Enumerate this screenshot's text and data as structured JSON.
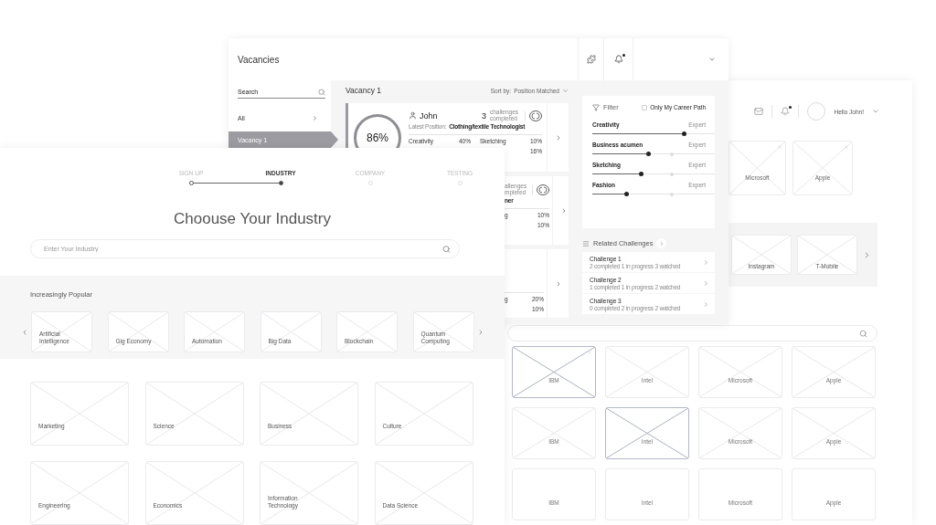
{
  "company_window": {
    "greeting": "Hello John!",
    "favorites": [
      {
        "label": "Microsoft"
      },
      {
        "label": "Apple"
      }
    ],
    "suggested": [
      {
        "label": "Instagram"
      },
      {
        "label": "T-Mobile"
      }
    ],
    "companies": [
      {
        "label": "IBM",
        "kind": "image",
        "selected": true
      },
      {
        "label": "Intel",
        "kind": "image",
        "selected": false
      },
      {
        "label": "Microsoft",
        "kind": "image",
        "selected": false
      },
      {
        "label": "Apple",
        "kind": "image",
        "selected": false
      },
      {
        "label": "IBM",
        "kind": "image",
        "selected": false
      },
      {
        "label": "Intel",
        "kind": "image",
        "selected": true
      },
      {
        "label": "Microsoft",
        "kind": "image",
        "selected": false
      },
      {
        "label": "Apple",
        "kind": "image",
        "selected": false
      },
      {
        "label": "IBM",
        "kind": "blank",
        "selected": false
      },
      {
        "label": "Intel",
        "kind": "blank",
        "selected": false
      },
      {
        "label": "Microsoft",
        "kind": "blank",
        "selected": false
      },
      {
        "label": "Apple",
        "kind": "blank",
        "selected": false
      }
    ]
  },
  "vacancies_window": {
    "title": "Vacancies",
    "sidebar": {
      "search": {
        "placeholder": "Search"
      },
      "items": [
        {
          "label": "All",
          "selected": false
        },
        {
          "label": "Vacancy 1",
          "selected": true
        }
      ]
    },
    "main": {
      "title": "Vacancy 1",
      "sort_label": "Sort by:",
      "sort_value": "Position Matched",
      "candidates": [
        {
          "kind": "full",
          "match": "86%",
          "name": "John",
          "challenges_count": "3",
          "challenges_label": "challenges completed",
          "position_label": "Latest Position:",
          "position": "Clothing/textile Technologist",
          "skill_rows": [
            [
              {
                "name": "Creativity",
                "value": "40%"
              },
              {
                "name": "Sketching",
                "value": "10%"
              }
            ],
            [
              {
                "value": "16%"
              }
            ]
          ]
        },
        {
          "kind": "partial",
          "challenges_label": "allenges mpleted",
          "position": "ner",
          "skill_rows": [
            [
              {
                "name": "g",
                "value": "10%"
              }
            ],
            [
              {
                "value": "10%"
              }
            ]
          ]
        },
        {
          "kind": "partial",
          "skill_rows": [
            [
              {
                "name": "g",
                "value": "20%"
              }
            ],
            [
              {
                "value": "10%"
              }
            ]
          ]
        }
      ]
    },
    "filter": {
      "title": "Filter",
      "career_path": {
        "label": "Only My Career Path",
        "checked": false
      },
      "skills": [
        {
          "name": "Creativity",
          "max_label": "Expert",
          "level": 0.75
        },
        {
          "name": "Business acumen",
          "max_label": "Expert",
          "level": 0.46,
          "benchmark": {
            "level": 0.65
          }
        },
        {
          "name": "Sketching",
          "max_label": "Expert",
          "level": 0.4,
          "benchmark": {
            "level": 0.65
          }
        },
        {
          "name": "Fashion",
          "max_label": "Expert",
          "level": 0.28,
          "benchmark": {
            "level": 0.65
          }
        }
      ]
    },
    "related": {
      "title": "Related Challenges",
      "challenges": [
        {
          "title": "Challenge 1",
          "completed": "2 completed",
          "in_progress": "1 in progress",
          "watched": "3 watched"
        },
        {
          "title": "Challenge 2",
          "completed": "1 completed",
          "in_progress": "1 in progress",
          "watched": "2 watched"
        },
        {
          "title": "Challenge 3",
          "completed": "0 completed",
          "in_progress": "2 in progress",
          "watched": "2 watched"
        }
      ]
    }
  },
  "industry_window": {
    "steps": [
      {
        "label": "SIGN UP",
        "completed": true,
        "selected": false
      },
      {
        "label": "INDUSTRY",
        "completed": false,
        "selected": true
      },
      {
        "label": "COMPANY",
        "completed": false,
        "selected": false
      },
      {
        "label": "TESTING",
        "completed": false,
        "selected": false
      }
    ],
    "title": "Choouse Your Industry",
    "search": {
      "placeholder": "Enter Your Industry"
    },
    "popular": {
      "title": "Increasingly Popular",
      "items": [
        {
          "label": "Artificial Intelligence"
        },
        {
          "label": "Gig Economy"
        },
        {
          "label": "Automation"
        },
        {
          "label": "Big Data"
        },
        {
          "label": "Blockchain"
        },
        {
          "label": "Quantum Computing"
        }
      ]
    },
    "industries": [
      {
        "label": "Marketing"
      },
      {
        "label": "Science"
      },
      {
        "label": "Business"
      },
      {
        "label": "Culture"
      },
      {
        "label": "Engineering"
      },
      {
        "label": "Economics"
      },
      {
        "label": "Information Technology"
      },
      {
        "label": "Data Science"
      }
    ]
  }
}
